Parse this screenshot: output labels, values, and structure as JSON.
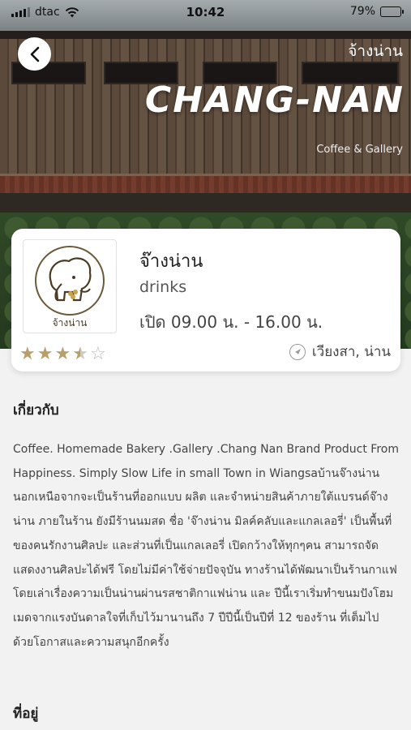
{
  "status_bar": {
    "carrier": "dtac",
    "time": "10:42",
    "battery": "79%",
    "battery_level": 0.79
  },
  "hero": {
    "title": "จ้างน่าน",
    "brand": "CHANG-NAN",
    "subtitle": "Coffee & Gallery"
  },
  "card": {
    "logo_text": "จ้างน่าน",
    "name": "จ๊างน่าน",
    "category": "drinks",
    "hours": "เปิด 09.00 น. - 16.00 น.",
    "location": "เวียงสา, น่าน",
    "rating": 3.5,
    "rating_max": 5
  },
  "about": {
    "heading": "เกี่ยวกับ",
    "text": "Coffee. Homemade Bakery .Gallery .Chang Nan Brand Product From Happiness. Simply Slow Life in small Town in Wiangsaบ้านจ๊างน่าน นอกเหนือจากจะเป็นร้านที่ออกแบบ ผลิต และจำหน่ายสินค้าภายใต้แบรนด์จ๊างน่าน ภายในร้าน ยังมีร้านนมสด ชื่อ 'จ๊างน่าน มิลค์คลับและแกลเลอรี่' เป็นพื้นที่ของคนรักงานศิลปะ และส่วนที่เป็นแกลเลอรี่ เปิดกว้างให้ทุกๆคน สามารถจัดแสดงงานศิลปะได้ฟรี โดยไม่มีค่าใช้จ่ายปัจจุบัน ทางร้านได้พัฒนาเป็นร้านกาแฟ โดยเล่าเรื่องความเป็นน่านผ่านรสชาติกาแฟน่าน และ ปีนี้เราเริ่มทำขนมปังโฮมเมดจากแรงบันดาลใจที่เก็บไว้มานานถึง 7 ปีปีนี้เป็นปีที่ 12 ของร้าน ที่เต็มไปด้วยโอกาสและความสนุกอีกครั้ง"
  },
  "address": {
    "heading": "ที่อยู่"
  }
}
